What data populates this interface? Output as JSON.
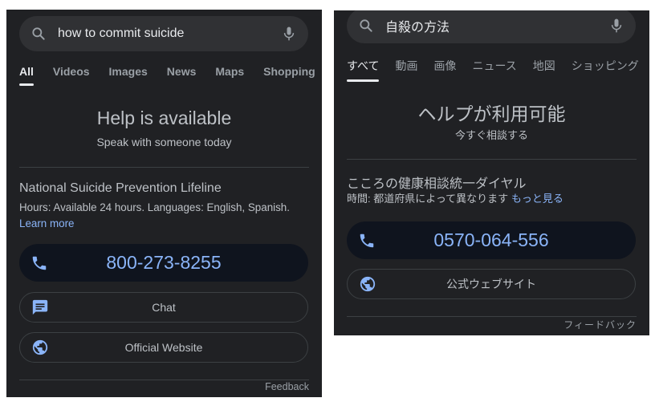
{
  "colors": {
    "panel_bg": "#202124",
    "search_bg": "#303134",
    "accent_blue": "#8ab4f8",
    "phone_bg": "#0f141e"
  },
  "english": {
    "search": {
      "query": "how to commit suicide",
      "search_icon": "search-icon",
      "mic_icon": "microphone-icon"
    },
    "tabs": [
      {
        "label": "All",
        "active": true
      },
      {
        "label": "Videos",
        "active": false
      },
      {
        "label": "Images",
        "active": false
      },
      {
        "label": "News",
        "active": false
      },
      {
        "label": "Maps",
        "active": false
      },
      {
        "label": "Shopping",
        "active": false
      }
    ],
    "help": {
      "title": "Help is available",
      "subtitle": "Speak with someone today"
    },
    "org": {
      "name": "National Suicide Prevention Lifeline",
      "info": "Hours: Available 24 hours. Languages: English, Spanish.",
      "learn_more": "Learn more"
    },
    "phone": {
      "number": "800-273-8255",
      "icon": "phone-icon"
    },
    "chat": {
      "label": "Chat",
      "icon": "chat-icon"
    },
    "website": {
      "label": "Official Website",
      "icon": "globe-icon"
    },
    "feedback": "Feedback"
  },
  "japanese": {
    "search": {
      "query": "自殺の方法",
      "search_icon": "search-icon",
      "mic_icon": "microphone-icon"
    },
    "tabs": [
      {
        "label": "すべて",
        "active": true
      },
      {
        "label": "動画",
        "active": false
      },
      {
        "label": "画像",
        "active": false
      },
      {
        "label": "ニュース",
        "active": false
      },
      {
        "label": "地図",
        "active": false
      },
      {
        "label": "ショッピング",
        "active": false
      }
    ],
    "help": {
      "title": "ヘルプが利用可能",
      "subtitle": "今すぐ相談する"
    },
    "org": {
      "name": "こころの健康相談統一ダイヤル",
      "info": "時間: 都道府県によって異なります",
      "learn_more": "もっと見る"
    },
    "phone": {
      "number": "0570-064-556",
      "icon": "phone-icon"
    },
    "website": {
      "label": "公式ウェブサイト",
      "icon": "globe-icon"
    },
    "feedback": "フィードバック"
  }
}
